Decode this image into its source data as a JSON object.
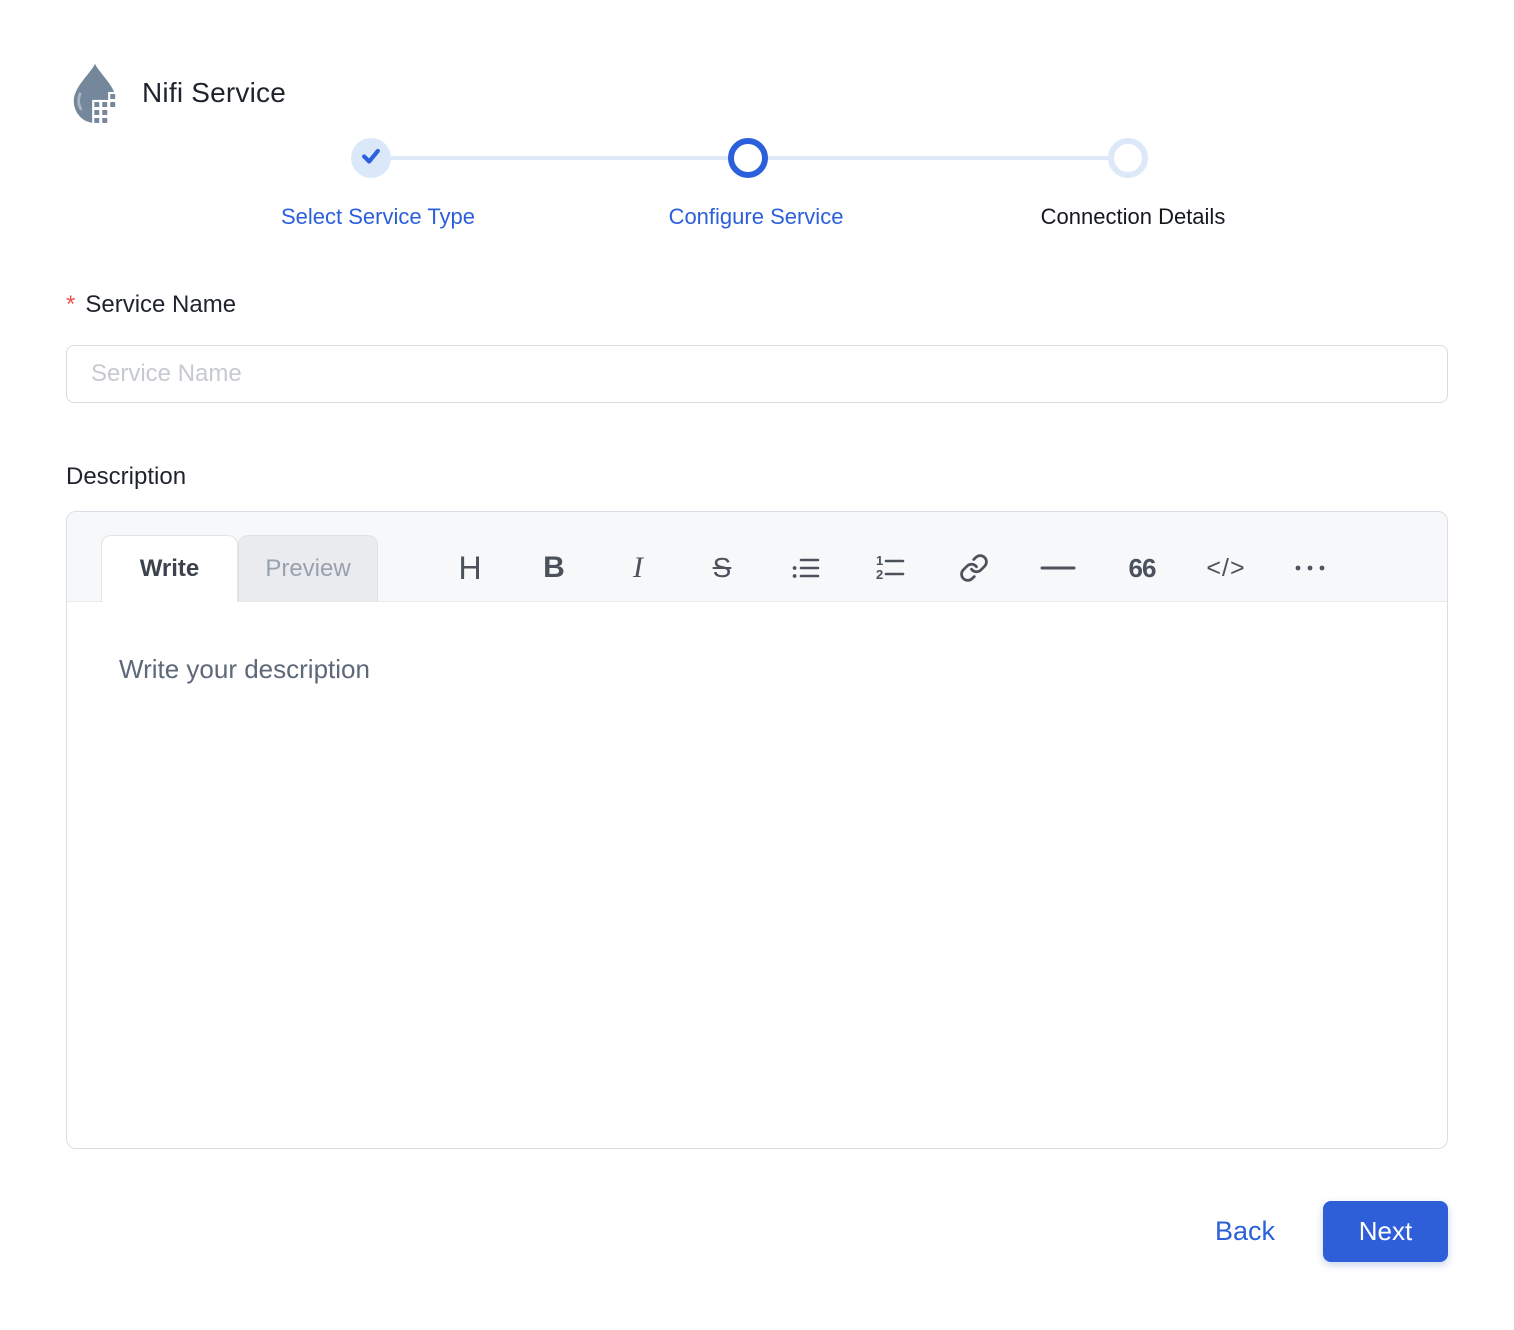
{
  "header": {
    "title": "Nifi Service",
    "icon": "nifi-drop-icon"
  },
  "stepper": {
    "steps": [
      {
        "label": "Select Service Type",
        "state": "completed"
      },
      {
        "label": "Configure Service",
        "state": "active"
      },
      {
        "label": "Connection Details",
        "state": "pending"
      }
    ]
  },
  "form": {
    "service_name": {
      "label": "Service Name",
      "required_marker": "*",
      "placeholder": "Service Name",
      "value": ""
    },
    "description": {
      "label": "Description",
      "editor": {
        "tabs": [
          {
            "label": "Write",
            "active": true
          },
          {
            "label": "Preview",
            "active": false
          }
        ],
        "toolbar": [
          {
            "name": "heading",
            "glyph": "H"
          },
          {
            "name": "bold",
            "glyph": "B"
          },
          {
            "name": "italic",
            "glyph": "I"
          },
          {
            "name": "strikethrough",
            "glyph": "S"
          },
          {
            "name": "unordered-list"
          },
          {
            "name": "ordered-list"
          },
          {
            "name": "link"
          },
          {
            "name": "horizontal-rule"
          },
          {
            "name": "quote",
            "glyph": "66"
          },
          {
            "name": "code",
            "glyph": "</>"
          },
          {
            "name": "more"
          }
        ],
        "placeholder": "Write your description",
        "value": ""
      }
    }
  },
  "footer": {
    "back_label": "Back",
    "next_label": "Next"
  },
  "colors": {
    "accent": "#2b5fdc",
    "accent_button": "#2e5fd9",
    "accent_soft": "#dde9f8",
    "required_red": "#ef5350",
    "logo_slate": "#75879a",
    "toolbar_bg": "#f7f8fa",
    "border": "#d9dee6"
  }
}
